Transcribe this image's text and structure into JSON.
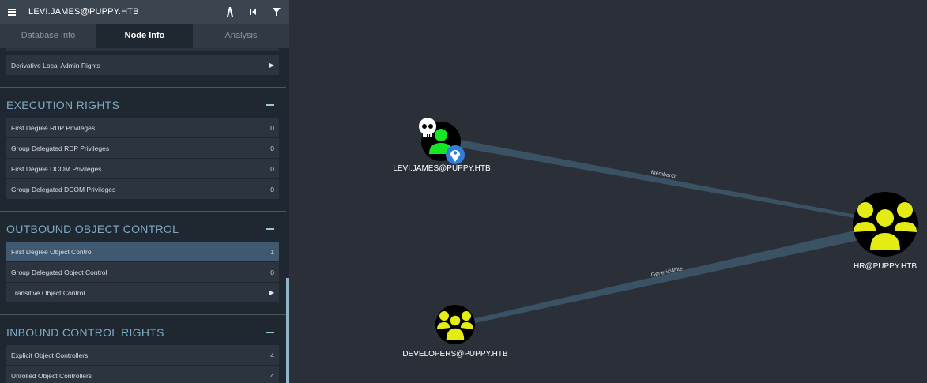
{
  "header": {
    "search_value": "LEVI.JAMES@PUPPY.HTB",
    "icons": [
      "menu-icon",
      "pathfinding-icon",
      "back-icon",
      "filter-icon"
    ]
  },
  "tabs": [
    {
      "label": "Database Info",
      "active": false
    },
    {
      "label": "Node Info",
      "active": true
    },
    {
      "label": "Analysis",
      "active": false
    }
  ],
  "panel": {
    "top_row": {
      "label": "Derivative Local Admin Rights",
      "value": "▶"
    },
    "execution": {
      "title": "EXECUTION RIGHTS",
      "rows": [
        {
          "label": "First Degree RDP Privileges",
          "value": "0"
        },
        {
          "label": "Group Delegated RDP Privileges",
          "value": "0"
        },
        {
          "label": "First Degree DCOM Privileges",
          "value": "0"
        },
        {
          "label": "Group Delegated DCOM Privileges",
          "value": "0"
        }
      ]
    },
    "outbound": {
      "title": "OUTBOUND OBJECT CONTROL",
      "rows": [
        {
          "label": "First Degree Object Control",
          "value": "1"
        },
        {
          "label": "Group Delegated Object Control",
          "value": "0"
        },
        {
          "label": "Transitive Object Control",
          "value": "▶"
        }
      ]
    },
    "inbound": {
      "title": "INBOUND CONTROL RIGHTS",
      "rows": [
        {
          "label": "Explicit Object Controllers",
          "value": "4"
        },
        {
          "label": "Unrolled Object Controllers",
          "value": "4"
        }
      ]
    }
  },
  "graph": {
    "nodes": {
      "levi": {
        "label": "LEVI.JAMES@PUPPY.HTB",
        "icon": "user-icon",
        "badges": [
          "owned-skull-icon",
          "starting-node-marker-icon"
        ]
      },
      "hr": {
        "label": "HR@PUPPY.HTB",
        "icon": "group-icon"
      },
      "developers": {
        "label": "DEVELOPERS@PUPPY.HTB",
        "icon": "group-icon"
      }
    },
    "edges": {
      "memberof": {
        "label": "MemberOf"
      },
      "genericwrite": {
        "label": "GenericWrite"
      }
    }
  },
  "colors": {
    "canvas_bg": "#2b3038",
    "panel_bg": "#1f2831",
    "row_bg": "#2c353f",
    "row_highlight": "#3f5970",
    "section_title": "#7fa9c3",
    "group_yellow": "#e4ec14",
    "user_green": "#17e625",
    "edge": "#3d5566"
  }
}
